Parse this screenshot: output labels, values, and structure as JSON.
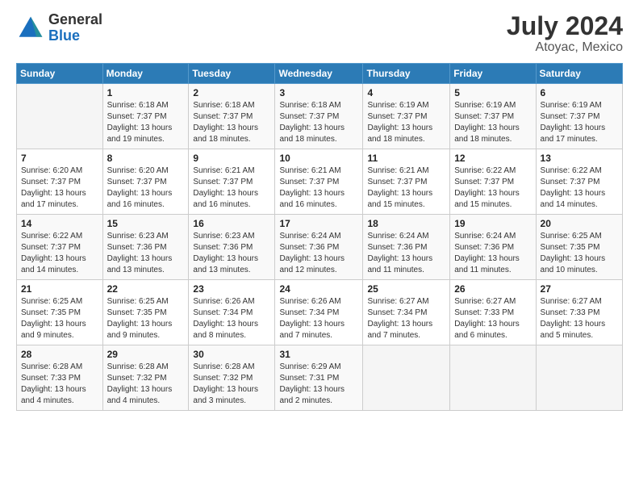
{
  "logo": {
    "general": "General",
    "blue": "Blue"
  },
  "title": {
    "month_year": "July 2024",
    "location": "Atoyac, Mexico"
  },
  "days_of_week": [
    "Sunday",
    "Monday",
    "Tuesday",
    "Wednesday",
    "Thursday",
    "Friday",
    "Saturday"
  ],
  "weeks": [
    [
      {
        "day": "",
        "info": ""
      },
      {
        "day": "1",
        "info": "Sunrise: 6:18 AM\nSunset: 7:37 PM\nDaylight: 13 hours\nand 19 minutes."
      },
      {
        "day": "2",
        "info": "Sunrise: 6:18 AM\nSunset: 7:37 PM\nDaylight: 13 hours\nand 18 minutes."
      },
      {
        "day": "3",
        "info": "Sunrise: 6:18 AM\nSunset: 7:37 PM\nDaylight: 13 hours\nand 18 minutes."
      },
      {
        "day": "4",
        "info": "Sunrise: 6:19 AM\nSunset: 7:37 PM\nDaylight: 13 hours\nand 18 minutes."
      },
      {
        "day": "5",
        "info": "Sunrise: 6:19 AM\nSunset: 7:37 PM\nDaylight: 13 hours\nand 18 minutes."
      },
      {
        "day": "6",
        "info": "Sunrise: 6:19 AM\nSunset: 7:37 PM\nDaylight: 13 hours\nand 17 minutes."
      }
    ],
    [
      {
        "day": "7",
        "info": "Sunrise: 6:20 AM\nSunset: 7:37 PM\nDaylight: 13 hours\nand 17 minutes."
      },
      {
        "day": "8",
        "info": "Sunrise: 6:20 AM\nSunset: 7:37 PM\nDaylight: 13 hours\nand 16 minutes."
      },
      {
        "day": "9",
        "info": "Sunrise: 6:21 AM\nSunset: 7:37 PM\nDaylight: 13 hours\nand 16 minutes."
      },
      {
        "day": "10",
        "info": "Sunrise: 6:21 AM\nSunset: 7:37 PM\nDaylight: 13 hours\nand 16 minutes."
      },
      {
        "day": "11",
        "info": "Sunrise: 6:21 AM\nSunset: 7:37 PM\nDaylight: 13 hours\nand 15 minutes."
      },
      {
        "day": "12",
        "info": "Sunrise: 6:22 AM\nSunset: 7:37 PM\nDaylight: 13 hours\nand 15 minutes."
      },
      {
        "day": "13",
        "info": "Sunrise: 6:22 AM\nSunset: 7:37 PM\nDaylight: 13 hours\nand 14 minutes."
      }
    ],
    [
      {
        "day": "14",
        "info": "Sunrise: 6:22 AM\nSunset: 7:37 PM\nDaylight: 13 hours\nand 14 minutes."
      },
      {
        "day": "15",
        "info": "Sunrise: 6:23 AM\nSunset: 7:36 PM\nDaylight: 13 hours\nand 13 minutes."
      },
      {
        "day": "16",
        "info": "Sunrise: 6:23 AM\nSunset: 7:36 PM\nDaylight: 13 hours\nand 13 minutes."
      },
      {
        "day": "17",
        "info": "Sunrise: 6:24 AM\nSunset: 7:36 PM\nDaylight: 13 hours\nand 12 minutes."
      },
      {
        "day": "18",
        "info": "Sunrise: 6:24 AM\nSunset: 7:36 PM\nDaylight: 13 hours\nand 11 minutes."
      },
      {
        "day": "19",
        "info": "Sunrise: 6:24 AM\nSunset: 7:36 PM\nDaylight: 13 hours\nand 11 minutes."
      },
      {
        "day": "20",
        "info": "Sunrise: 6:25 AM\nSunset: 7:35 PM\nDaylight: 13 hours\nand 10 minutes."
      }
    ],
    [
      {
        "day": "21",
        "info": "Sunrise: 6:25 AM\nSunset: 7:35 PM\nDaylight: 13 hours\nand 9 minutes."
      },
      {
        "day": "22",
        "info": "Sunrise: 6:25 AM\nSunset: 7:35 PM\nDaylight: 13 hours\nand 9 minutes."
      },
      {
        "day": "23",
        "info": "Sunrise: 6:26 AM\nSunset: 7:34 PM\nDaylight: 13 hours\nand 8 minutes."
      },
      {
        "day": "24",
        "info": "Sunrise: 6:26 AM\nSunset: 7:34 PM\nDaylight: 13 hours\nand 7 minutes."
      },
      {
        "day": "25",
        "info": "Sunrise: 6:27 AM\nSunset: 7:34 PM\nDaylight: 13 hours\nand 7 minutes."
      },
      {
        "day": "26",
        "info": "Sunrise: 6:27 AM\nSunset: 7:33 PM\nDaylight: 13 hours\nand 6 minutes."
      },
      {
        "day": "27",
        "info": "Sunrise: 6:27 AM\nSunset: 7:33 PM\nDaylight: 13 hours\nand 5 minutes."
      }
    ],
    [
      {
        "day": "28",
        "info": "Sunrise: 6:28 AM\nSunset: 7:33 PM\nDaylight: 13 hours\nand 4 minutes."
      },
      {
        "day": "29",
        "info": "Sunrise: 6:28 AM\nSunset: 7:32 PM\nDaylight: 13 hours\nand 4 minutes."
      },
      {
        "day": "30",
        "info": "Sunrise: 6:28 AM\nSunset: 7:32 PM\nDaylight: 13 hours\nand 3 minutes."
      },
      {
        "day": "31",
        "info": "Sunrise: 6:29 AM\nSunset: 7:31 PM\nDaylight: 13 hours\nand 2 minutes."
      },
      {
        "day": "",
        "info": ""
      },
      {
        "day": "",
        "info": ""
      },
      {
        "day": "",
        "info": ""
      }
    ]
  ]
}
